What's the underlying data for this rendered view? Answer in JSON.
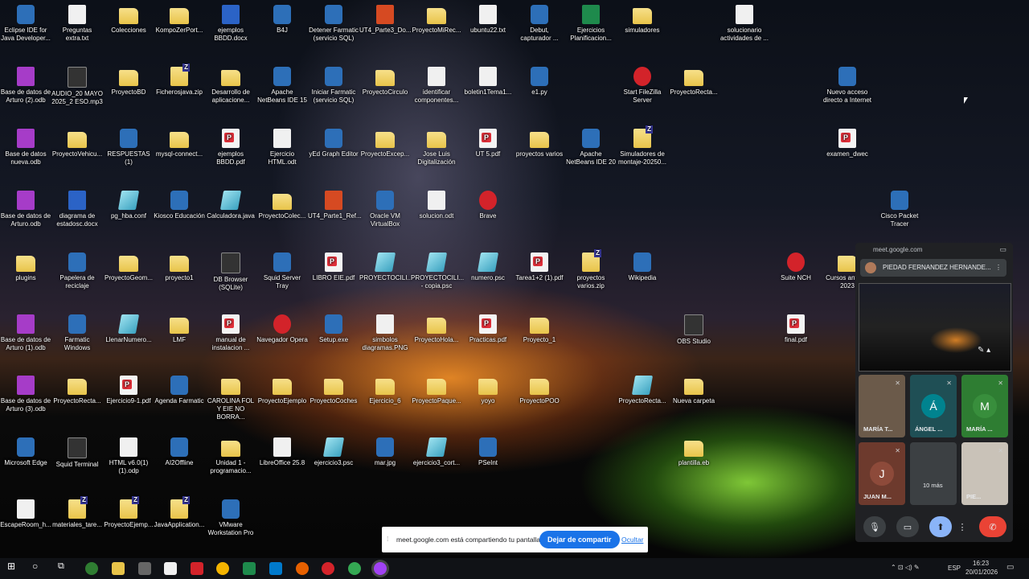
{
  "desktop": {
    "icons": [
      {
        "label": "Eclipse IDE for Java Developer...",
        "kind": "app"
      },
      {
        "label": "Preguntas extra.txt",
        "kind": "txt"
      },
      {
        "label": "Colecciones",
        "kind": "folder"
      },
      {
        "label": "KompoZerPort...",
        "kind": "folder"
      },
      {
        "label": "ejemplos BBDD.docx",
        "kind": "word"
      },
      {
        "label": "B4J",
        "kind": "app"
      },
      {
        "label": "Detener Farmatic (servicio SQL)",
        "kind": "app"
      },
      {
        "label": "UT4_Parte3_Do...",
        "kind": "ppt"
      },
      {
        "label": "ProyectoMiRec...",
        "kind": "folder"
      },
      {
        "label": "ubuntu22.txt",
        "kind": "txt"
      },
      {
        "label": "Debut, capturador ...",
        "kind": "app"
      },
      {
        "label": "Ejercicios Planificacion...",
        "kind": "excel"
      },
      {
        "label": "simuladores",
        "kind": "folder"
      },
      {
        "label": "solucionario actividades de ...",
        "kind": "txt"
      },
      {
        "label": "Base de datos de Arturo (2).odb",
        "kind": "odb"
      },
      {
        "label": "AUDIO_20 MAYO 2025_2 ESO.mp3",
        "kind": "dark"
      },
      {
        "label": "ProyectoBD",
        "kind": "folder"
      },
      {
        "label": "Ficherosjava.zip",
        "kind": "zip"
      },
      {
        "label": "Desarrollo de aplicacione...",
        "kind": "folder"
      },
      {
        "label": "Apache NetBeans IDE 15",
        "kind": "app"
      },
      {
        "label": "Iniciar Farmatic (servicio SQL)",
        "kind": "app"
      },
      {
        "label": "ProyectoCirculo",
        "kind": "folder"
      },
      {
        "label": "identificar componentes...",
        "kind": "txt"
      },
      {
        "label": "boletin1Tema1...",
        "kind": "txt"
      },
      {
        "label": "e1.py",
        "kind": "app"
      },
      {
        "label": "Start FileZilla Server",
        "kind": "red"
      },
      {
        "label": "ProyectoRecta...",
        "kind": "folder"
      },
      {
        "label": "Nuevo acceso directo a Internet",
        "kind": "app"
      },
      {
        "label": "Base de datos nueva.odb",
        "kind": "odb"
      },
      {
        "label": "ProyectoVehicu...",
        "kind": "folder"
      },
      {
        "label": "RESPUESTAS (1)",
        "kind": "app"
      },
      {
        "label": "mysql-connect...",
        "kind": "folder"
      },
      {
        "label": "ejemplos BBDD.pdf",
        "kind": "pdf"
      },
      {
        "label": "Ejercicio HTML.odt",
        "kind": "txt"
      },
      {
        "label": "yEd Graph Editor",
        "kind": "app"
      },
      {
        "label": "ProyectoExcep...",
        "kind": "folder"
      },
      {
        "label": "Jose Luis Digitalización",
        "kind": "folder"
      },
      {
        "label": "UT 5.pdf",
        "kind": "pdf"
      },
      {
        "label": "proyectos varios",
        "kind": "folder"
      },
      {
        "label": "Apache NetBeans IDE 20",
        "kind": "app"
      },
      {
        "label": "Simuladores de montaje-20250...",
        "kind": "zip"
      },
      {
        "label": "examen_dwec",
        "kind": "pdf"
      },
      {
        "label": "Base de datos de Arturo.odb",
        "kind": "odb"
      },
      {
        "label": "diagrama de estadosc.docx",
        "kind": "word"
      },
      {
        "label": "pg_hba.conf",
        "kind": "psc"
      },
      {
        "label": "Kiosco Educación",
        "kind": "app"
      },
      {
        "label": "Calculadora.java",
        "kind": "psc"
      },
      {
        "label": "ProyectoColec...",
        "kind": "folder"
      },
      {
        "label": "UT4_Parte1_Ref...",
        "kind": "ppt"
      },
      {
        "label": "Oracle VM VirtualBox",
        "kind": "app"
      },
      {
        "label": "solucion.odt",
        "kind": "txt"
      },
      {
        "label": "Brave",
        "kind": "red"
      },
      {
        "label": "Cisco Packet Tracer",
        "kind": "app"
      },
      {
        "label": "plugins",
        "kind": "folder"
      },
      {
        "label": "Papelera de reciclaje",
        "kind": "app"
      },
      {
        "label": "ProyectoGeom...",
        "kind": "folder"
      },
      {
        "label": "proyecto1",
        "kind": "folder"
      },
      {
        "label": "DB Browser (SQLite)",
        "kind": "dark"
      },
      {
        "label": "Squid Server Tray",
        "kind": "app"
      },
      {
        "label": "LIBRO EIE.pdf",
        "kind": "pdf"
      },
      {
        "label": "PROYECTOCILI...",
        "kind": "psc"
      },
      {
        "label": "PROYECTOCILI... - copia.psc",
        "kind": "psc"
      },
      {
        "label": "numero.psc",
        "kind": "psc"
      },
      {
        "label": "Tarea1+2 (1).pdf",
        "kind": "pdf"
      },
      {
        "label": "proyectos varios.zip",
        "kind": "zip"
      },
      {
        "label": "Wikipedia",
        "kind": "app"
      },
      {
        "label": "Suite NCH",
        "kind": "red"
      },
      {
        "label": "Cursos anti... a 2023",
        "kind": "folder"
      },
      {
        "label": "Base de datos de Arturo (1).odb",
        "kind": "odb"
      },
      {
        "label": "Farmatic Windows",
        "kind": "app"
      },
      {
        "label": "LlenarNumero...",
        "kind": "psc"
      },
      {
        "label": "LMF",
        "kind": "folder"
      },
      {
        "label": "manual de instalacion ...",
        "kind": "pdf"
      },
      {
        "label": "Navegador Opera",
        "kind": "red"
      },
      {
        "label": "Setup.exe",
        "kind": "app"
      },
      {
        "label": "simbolos diagramas.PNG",
        "kind": "txt"
      },
      {
        "label": "ProyectoHola...",
        "kind": "folder"
      },
      {
        "label": "Practicas.pdf",
        "kind": "pdf"
      },
      {
        "label": "Proyecto_1",
        "kind": "folder"
      },
      {
        "label": "OBS Studio",
        "kind": "dark"
      },
      {
        "label": "final.pdf",
        "kind": "pdf"
      },
      {
        "label": "Base de datos de Arturo (3).odb",
        "kind": "odb"
      },
      {
        "label": "ProyectoRecta...",
        "kind": "folder"
      },
      {
        "label": "Ejercicio9-1.pdf",
        "kind": "pdf"
      },
      {
        "label": "Agenda Farmatic",
        "kind": "app"
      },
      {
        "label": "CAROLINA FOL Y EIE NO BORRA...",
        "kind": "folder"
      },
      {
        "label": "ProyectoEjemplo",
        "kind": "folder"
      },
      {
        "label": "ProyectoCoches",
        "kind": "folder"
      },
      {
        "label": "Ejercicio_6",
        "kind": "folder"
      },
      {
        "label": "ProyectoPaque...",
        "kind": "folder"
      },
      {
        "label": "yoyo",
        "kind": "folder"
      },
      {
        "label": "ProyectoPOO",
        "kind": "folder"
      },
      {
        "label": "ProyectoRecta...",
        "kind": "psc"
      },
      {
        "label": "Nueva carpeta",
        "kind": "folder"
      },
      {
        "label": "Microsoft Edge",
        "kind": "app"
      },
      {
        "label": "Squid Terminal",
        "kind": "dark"
      },
      {
        "label": "HTML v6.0(1) (1).odp",
        "kind": "txt"
      },
      {
        "label": "AI2Offline",
        "kind": "app"
      },
      {
        "label": "Unidad 1 - programacio...",
        "kind": "folder"
      },
      {
        "label": "LibreOffice 25.8",
        "kind": "txt"
      },
      {
        "label": "ejercicio3.psc",
        "kind": "psc"
      },
      {
        "label": "mar.jpg",
        "kind": "app"
      },
      {
        "label": "ejercicio3_cort...",
        "kind": "psc"
      },
      {
        "label": "PSeInt",
        "kind": "app"
      },
      {
        "label": "plantilla.eb",
        "kind": "folder"
      },
      {
        "label": "EscapeRoom_h...",
        "kind": "txt"
      },
      {
        "label": "materiales_tare...",
        "kind": "zip"
      },
      {
        "label": "ProyectoEjemp...",
        "kind": "zip"
      },
      {
        "label": "JavaApplication...",
        "kind": "zip"
      },
      {
        "label": "VMware Workstation Pro",
        "kind": "app"
      }
    ]
  },
  "meet": {
    "url": "meet.google.com",
    "presenter": "PIEDAD FERNANDEZ HERNANDE...",
    "tiles": [
      {
        "label": "MARÍA T...",
        "initial": "",
        "color": "#6b5a4a"
      },
      {
        "label": "ÁNGEL ...",
        "initial": "Á",
        "color": "#00838f"
      },
      {
        "label": "MARÍA ...",
        "initial": "M",
        "color": "#388e3c"
      },
      {
        "label": "JUAN M...",
        "initial": "J",
        "color": "#8d4a3a"
      },
      {
        "label": "10 más",
        "initial": "",
        "color": "#3c4043"
      },
      {
        "label": "PIE...",
        "initial": "",
        "color": "#c9c2b8"
      }
    ]
  },
  "sharebar": {
    "message": "meet.google.com está compartiendo tu pantalla.",
    "stop_label": "Dejar de compartir",
    "hide_label": "Ocultar"
  },
  "taskbar": {
    "language": "ESP",
    "time": "16:23",
    "date": "20/01/2026"
  }
}
